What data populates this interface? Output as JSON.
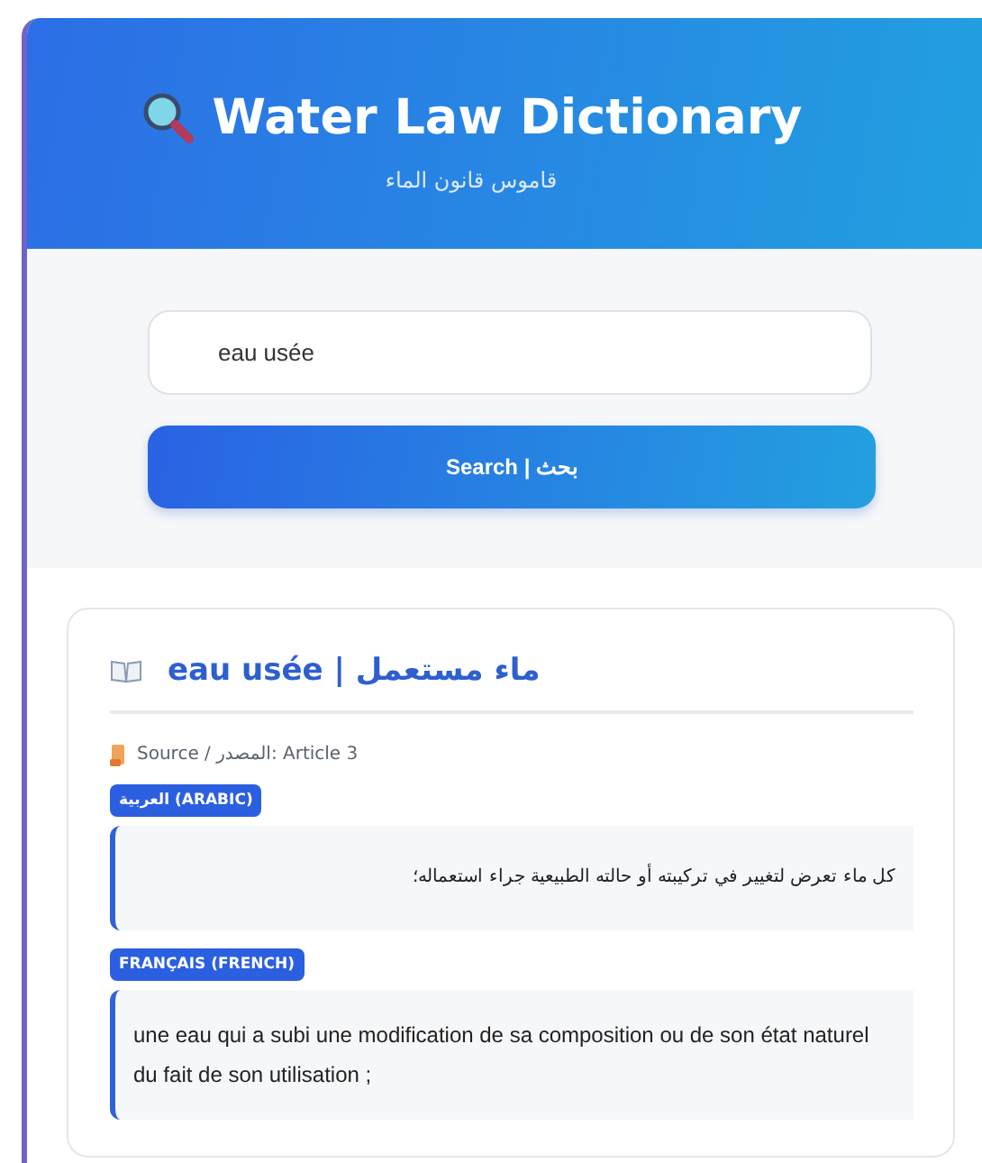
{
  "header": {
    "title": "Water Law Dictionary",
    "subtitle": "قاموس قانون الماء"
  },
  "search": {
    "value": "eau usée",
    "button": "Search | بحث"
  },
  "result": {
    "term": "eau usée | ماء مستعمل",
    "source": "Source / المصدر: Article 3",
    "definitions": [
      {
        "language": "العربية (ARABIC)",
        "kind": "rtl",
        "text": "كل ماء تعرض لتغيير في تركيبته أو حالته الطبيعية جراء استعماله؛"
      },
      {
        "language": "FRANÇAIS (FRENCH)",
        "kind": "ltr",
        "text": "une eau qui a subi une modification de sa composition ou de son état naturel du fait de son utilisation ;"
      }
    ]
  }
}
